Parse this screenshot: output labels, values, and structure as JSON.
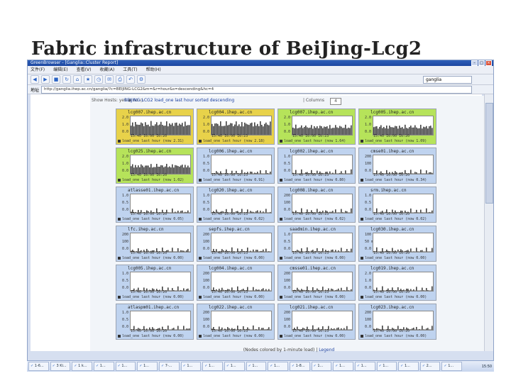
{
  "slide": {
    "title": "Fabric infrastructure of BeiJing-Lcg2"
  },
  "window": {
    "title": "GreenBrowser - [Ganglia::Cluster Report]"
  },
  "menu": [
    "文件(F)",
    "编辑(E)",
    "查看(V)",
    "收藏(A)",
    "工具(T)",
    "帮助(H)"
  ],
  "search": {
    "value": "ganglia"
  },
  "address": {
    "label": "地址",
    "value": "http://ganglia.ihep.ac.cn/ganglia/?c=BEIJING-LCG2&m=&r=hour&s=descending&hc=4"
  },
  "header": {
    "prefix": "Show Hosts: yes ◉ no ○",
    "cluster_title": "BEIJING-LCG2 load_one last hour sorted descending",
    "columns_label": "| Columns",
    "columns_value": "4"
  },
  "graph_legend": "load_one last hour (now",
  "footer": {
    "text": "(Nodes colored by 1-minute load) |",
    "link": "Legend"
  },
  "colors": {
    "high": "#e8d24a",
    "medium": "#b6e35a",
    "low": "#bfd3ef"
  },
  "cells": [
    {
      "name": "lcg007.ihep.ac.cn",
      "color": "high",
      "yticks": [
        "2.0",
        "1.0",
        "0.0"
      ],
      "x": "15:40  16:00  16:20",
      "now": "2.31"
    },
    {
      "name": "lcg004.ihep.ac.cn",
      "color": "high",
      "yticks": [
        "2.0",
        "1.0",
        "0.0"
      ],
      "x": "15:40  16:00  16:23",
      "now": "2.18"
    },
    {
      "name": "lcg007.ihep.ac.cn",
      "color": "medium",
      "yticks": [
        "2.0",
        "1.0",
        "0.0"
      ],
      "x": "15:40  16:00  16:23",
      "now": "1.64"
    },
    {
      "name": "lcg005.ihep.ac.cn",
      "color": "medium",
      "yticks": [
        "2.0",
        "1.0",
        "0.0"
      ],
      "x": "15:40  16:00  16:20",
      "now": "1.09"
    },
    {
      "name": "lcg025.ihep.ac.cn",
      "color": "medium",
      "yticks": [
        "2.0",
        "1.0",
        "0.0"
      ],
      "x": "15:40  16:00  16:20",
      "now": "1.02"
    },
    {
      "name": "lcg006.ihep.ac.cn",
      "color": "low",
      "yticks": [
        "1.0",
        "0.5",
        "0.0"
      ],
      "x": "15:40  16:00  16:23",
      "now": "0.91"
    },
    {
      "name": "lcg002.ihep.ac.cn",
      "color": "low",
      "yticks": [
        "1.0",
        "0.5",
        "0.0"
      ],
      "x": "15:40  16:00  16:23",
      "now": "0.80"
    },
    {
      "name": "cmse01.ihep.ac.cn",
      "color": "low",
      "yticks": [
        "200 m",
        "100 m",
        "0.0"
      ],
      "x": "15:40  16:00  16:20",
      "now": "0.34"
    },
    {
      "name": "atlasse01.ihep.ac.cn",
      "color": "low",
      "yticks": [
        "1.0",
        "0.5",
        "0.0"
      ],
      "x": "15:40  16:00  16:20",
      "now": "0.05"
    },
    {
      "name": "lcg020.ihep.ac.cn",
      "color": "low",
      "yticks": [
        "1.0",
        "0.5",
        "0.0"
      ],
      "x": "15:40  16:00  16:23",
      "now": "0.02"
    },
    {
      "name": "lcg008.ihep.ac.cn",
      "color": "low",
      "yticks": [
        "200 m",
        "100 m",
        "0.0"
      ],
      "x": "15:40  16:00  16:23",
      "now": "0.02"
    },
    {
      "name": "srm.ihep.ac.cn",
      "color": "low",
      "yticks": [
        "1.0",
        "0.5",
        "0.0"
      ],
      "x": "15:40  16:00  16:20",
      "now": "0.02"
    },
    {
      "name": "lfc.ihep.ac.cn",
      "color": "low",
      "yticks": [
        "200 m",
        "100 m",
        "0.0"
      ],
      "x": "15:40  16:00  16:20",
      "now": "0.00"
    },
    {
      "name": "sepfs.ihep.ac.cn",
      "color": "low",
      "yticks": [
        "200 m",
        "100 m",
        "0.0"
      ],
      "x": "15:40  16:00  16:23",
      "now": "0.00"
    },
    {
      "name": "saadmin.ihep.ac.cn",
      "color": "low",
      "yticks": [
        "1.0",
        "0.5",
        "0.0"
      ],
      "x": "15:40  16:00  16:23",
      "now": "0.00"
    },
    {
      "name": "lcg030.ihep.ac.cn",
      "color": "low",
      "yticks": [
        "100 m",
        "50 m",
        "0.0"
      ],
      "x": "15:40  16:00  16:20",
      "now": "0.00"
    },
    {
      "name": "lcg005.ihep.ac.cn",
      "color": "low",
      "yticks": [
        "1.0",
        "0.5",
        "0.0"
      ],
      "x": "15:40  16:00  16:20",
      "now": "0.00"
    },
    {
      "name": "lcg004.ihep.ac.cn",
      "color": "low",
      "yticks": [
        "200 m",
        "100 m",
        "0.0"
      ],
      "x": "15:40  16:00  16:23",
      "now": "0.00"
    },
    {
      "name": "cmsse01.ihep.ac.cn",
      "color": "low",
      "yticks": [
        "200 m",
        "100 m",
        "0.0"
      ],
      "x": "15:40  16:00  16:23",
      "now": "0.00"
    },
    {
      "name": "lcg019.ihep.ac.cn",
      "color": "low",
      "yticks": [
        "2.0",
        "1.0",
        "0.0"
      ],
      "x": "15:40  16:00  16:20",
      "now": "0.00"
    },
    {
      "name": "atlaspm01.ihep.ac.cn",
      "color": "low",
      "yticks": [
        "1.0",
        "0.5",
        "0.0"
      ],
      "x": "15:40  16:00  16:20",
      "now": "0.00"
    },
    {
      "name": "lcg022.ihep.ac.cn",
      "color": "low",
      "yticks": [
        "200 m",
        "100 m",
        "0.0"
      ],
      "x": "15:40  16:00  16:23",
      "now": "0.00"
    },
    {
      "name": "lcg021.ihep.ac.cn",
      "color": "low",
      "yticks": [
        "200 m",
        "100 m",
        "0.0"
      ],
      "x": "15:40  16:00  16:23",
      "now": "0.00"
    },
    {
      "name": "lcg023.ihep.ac.cn",
      "color": "low",
      "yticks": [
        "200 m",
        "100 m",
        "0.0"
      ],
      "x": "15:40  16:00  16:20",
      "now": "0.00"
    }
  ],
  "taskbar": [
    "1-6...",
    "3 Ki...",
    "1 k...",
    "1...",
    "1...",
    "1...",
    "7-...",
    "1...",
    "1...",
    "1...",
    "1...",
    "1...",
    "1-8...",
    "1...",
    "1...",
    "1...",
    "1...",
    "1...",
    "2...",
    "1..."
  ],
  "clock": "15:50"
}
